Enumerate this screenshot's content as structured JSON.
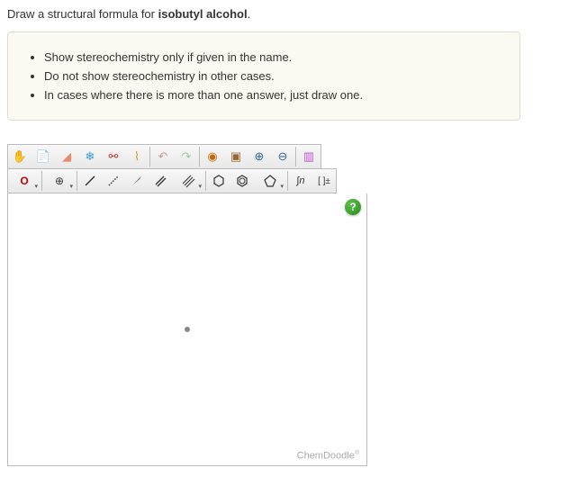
{
  "prompt": {
    "prefix": "Draw a structural formula for ",
    "compound": "isobutyl alcohol",
    "suffix": "."
  },
  "hints": [
    "Show stereochemistry only if given in the name.",
    "Do not show stereochemistry in other cases.",
    "In cases where there is more than one answer, just draw one."
  ],
  "toolbar": {
    "row1": [
      {
        "name": "hand-icon",
        "gly": "✋"
      },
      {
        "name": "paste-icon",
        "gly": "📄"
      },
      {
        "name": "eraser-icon",
        "gly": "◢",
        "color": "#e86"
      },
      {
        "name": "snowflake-icon",
        "gly": "❄",
        "color": "#39c"
      },
      {
        "name": "chain-icon",
        "gly": "⚯",
        "color": "#c33"
      },
      {
        "name": "group-icon",
        "gly": "⌇",
        "color": "#c93"
      },
      {
        "name": "undo-icon",
        "gly": "↶",
        "color": "#c99"
      },
      {
        "name": "redo-icon",
        "gly": "↷",
        "color": "#9c9"
      },
      {
        "name": "color-icon",
        "gly": "◉",
        "color": "#c60"
      },
      {
        "name": "view-icon",
        "gly": "▣",
        "color": "#963"
      },
      {
        "name": "zoom-in-icon",
        "gly": "⊕",
        "color": "#369"
      },
      {
        "name": "zoom-out-icon",
        "gly": "⊖",
        "color": "#369"
      },
      {
        "name": "palette-icon",
        "gly": "▥",
        "color": "#b5c"
      }
    ],
    "row2_element": "O",
    "row2_charge_gly": "⊕",
    "bonds": [
      {
        "name": "single-bond-icon"
      },
      {
        "name": "dotted-bond-icon"
      },
      {
        "name": "wedge-bond-icon"
      },
      {
        "name": "double-bond-icon"
      },
      {
        "name": "triple-bond-icon"
      }
    ],
    "rings": [
      {
        "name": "hexagon-icon",
        "sides": 6
      },
      {
        "name": "benzene-icon",
        "sides": 6,
        "inner": true
      },
      {
        "name": "pentagon-icon",
        "sides": 5
      }
    ],
    "sn_label": "∫n",
    "bracket_gly": "[ ]±",
    "help_label": "?",
    "brand": "ChemDoodle",
    "brand_mark": "®"
  }
}
